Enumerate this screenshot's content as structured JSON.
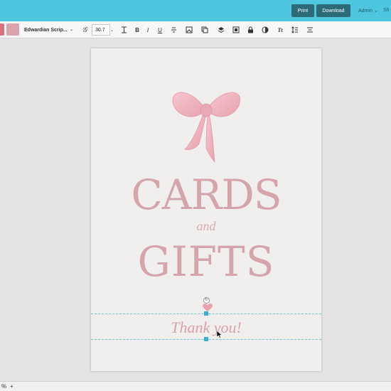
{
  "topbar": {
    "print_label": "Print",
    "download_label": "Download",
    "admin_label": "Admin",
    "share_label": "Sh"
  },
  "toolbar": {
    "font_name": "Edwardian Scrip...",
    "font_size": "30.7",
    "icons": [
      "font-style-icon",
      "letter-spacing-icon",
      "bold-icon",
      "italic-icon",
      "underline-icon",
      "strikethrough-icon",
      "image-icon",
      "duplicate-icon",
      "layers-icon",
      "align-icon",
      "lock-icon",
      "color-icon",
      "text-transform-icon",
      "line-height-icon",
      "text-align-icon"
    ],
    "bold": "B",
    "italic": "I",
    "underline": "U",
    "tt": "Tt"
  },
  "design": {
    "line1": "CARDS",
    "line2": "and",
    "line3": "GIFTS",
    "thanks": "Thank you!"
  },
  "bottom": {
    "left_glyph": "%",
    "add": "+"
  },
  "colors": {
    "topbar": "#4fc6df",
    "button": "#2c6a78",
    "text_pink": "#d4a5ab"
  }
}
